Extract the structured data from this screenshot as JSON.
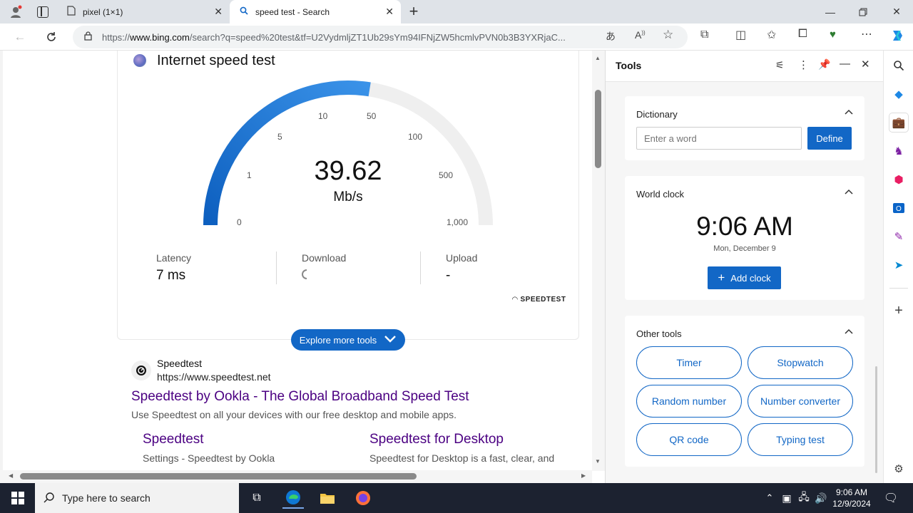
{
  "browser": {
    "tabs": [
      {
        "title": "pixel (1×1)",
        "active": false
      },
      {
        "title": "speed test - Search",
        "active": true
      }
    ],
    "url": {
      "scheme": "https://",
      "host": "www.bing.com",
      "path": "/search?q=speed%20test&tf=U2VydmljZT1Ub29sYm94IFNjZW5hcmlvPVN0b3B3YXRjaC..."
    }
  },
  "speedtest": {
    "title": "Internet speed test",
    "gauge_value": "39.62",
    "gauge_unit": "Mb/s",
    "scale_labels": [
      "0",
      "1",
      "5",
      "10",
      "50",
      "100",
      "500",
      "1,000"
    ],
    "gauge_fraction": 0.55,
    "latency_label": "Latency",
    "latency_value": "7 ms",
    "download_label": "Download",
    "upload_label": "Upload",
    "upload_value": "-",
    "brand": "SPEEDTEST",
    "explore_label": "Explore more tools"
  },
  "result": {
    "site_name": "Speedtest",
    "site_url": "https://www.speedtest.net",
    "title": "Speedtest by Ookla - The Global Broadband Speed Test",
    "snippet": "Use Speedtest on all your devices with our free desktop and mobile apps.",
    "sub1_title": "Speedtest",
    "sub1_text": "Settings - Speedtest by Ookla",
    "sub2_title": "Speedtest for Desktop",
    "sub2_text": "Speedtest for Desktop is a fast, clear, and"
  },
  "tools": {
    "title": "Tools",
    "dictionary_title": "Dictionary",
    "dictionary_placeholder": "Enter a word",
    "define_label": "Define",
    "worldclock_title": "World clock",
    "clock_time": "9:06 AM",
    "clock_date": "Mon, December 9",
    "add_clock_label": "Add clock",
    "other_title": "Other tools",
    "buttons": [
      "Timer",
      "Stopwatch",
      "Random number",
      "Number converter",
      "QR code",
      "Typing test"
    ]
  },
  "taskbar": {
    "search_placeholder": "Type here to search",
    "time": "9:06 AM",
    "date": "12/9/2024"
  },
  "colors": {
    "accent": "#1267c6",
    "link_visited": "#4b0082"
  }
}
